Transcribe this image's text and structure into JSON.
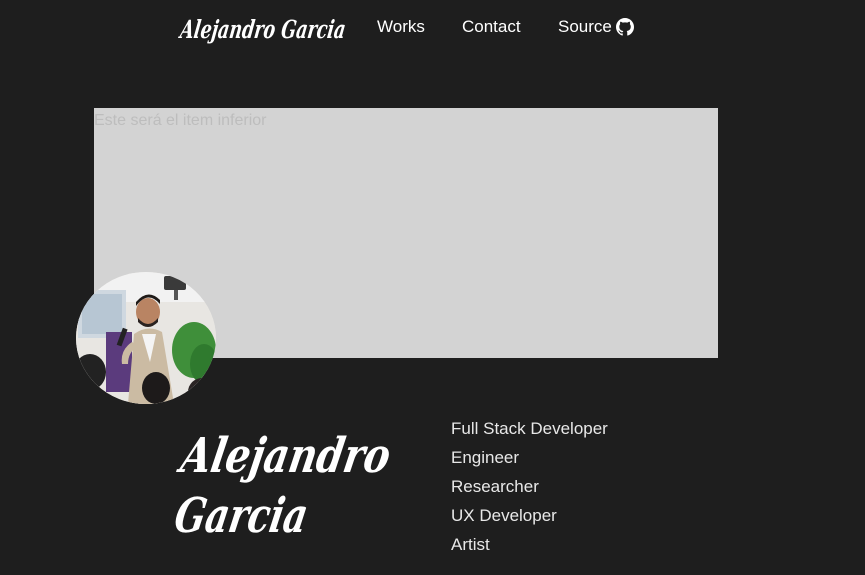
{
  "header": {
    "logo_text": "Alejandro Garcia",
    "nav": {
      "works_label": "Works",
      "contact_label": "Contact",
      "source_label": "Source",
      "source_icon": "github-icon"
    }
  },
  "hero": {
    "placeholder_text": "Este será el item inferior",
    "box_color": "#d3d3d3"
  },
  "profile": {
    "logo_line1": "Alejandro",
    "logo_line2": "Garcia",
    "roles": [
      "Full Stack Developer",
      "Engineer",
      "Researcher",
      "UX Developer",
      "Artist"
    ]
  },
  "theme": {
    "background": "#1e1e1e",
    "text": "#ffffff"
  }
}
